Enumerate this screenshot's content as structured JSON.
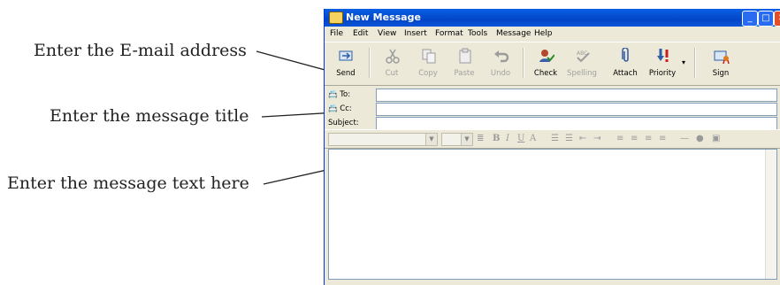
{
  "callouts": {
    "email": "Enter the E-mail address",
    "title": "Enter the message title",
    "text": "Enter the message text here"
  },
  "window": {
    "title": "New Message",
    "menu": [
      "File",
      "Edit",
      "View",
      "Insert",
      "Format",
      "Tools",
      "Message",
      "Help"
    ],
    "toolbar": [
      {
        "label": "Send",
        "icon": "send-icon",
        "enabled": true
      },
      {
        "label": "Cut",
        "icon": "cut-icon",
        "enabled": false
      },
      {
        "label": "Copy",
        "icon": "copy-icon",
        "enabled": false
      },
      {
        "label": "Paste",
        "icon": "paste-icon",
        "enabled": false
      },
      {
        "label": "Undo",
        "icon": "undo-icon",
        "enabled": false
      },
      {
        "label": "Check",
        "icon": "check-names-icon",
        "enabled": true
      },
      {
        "label": "Spelling",
        "icon": "spelling-icon",
        "enabled": false
      },
      {
        "label": "Attach",
        "icon": "paperclip-icon",
        "enabled": true
      },
      {
        "label": "Priority",
        "icon": "priority-icon",
        "enabled": true
      },
      {
        "label": "Sign",
        "icon": "sign-icon",
        "enabled": true
      }
    ],
    "fields": {
      "to_label": "To:",
      "cc_label": "Cc:",
      "subject_label": "Subject:",
      "to_value": "",
      "cc_value": "",
      "subject_value": ""
    },
    "body_text": ""
  }
}
